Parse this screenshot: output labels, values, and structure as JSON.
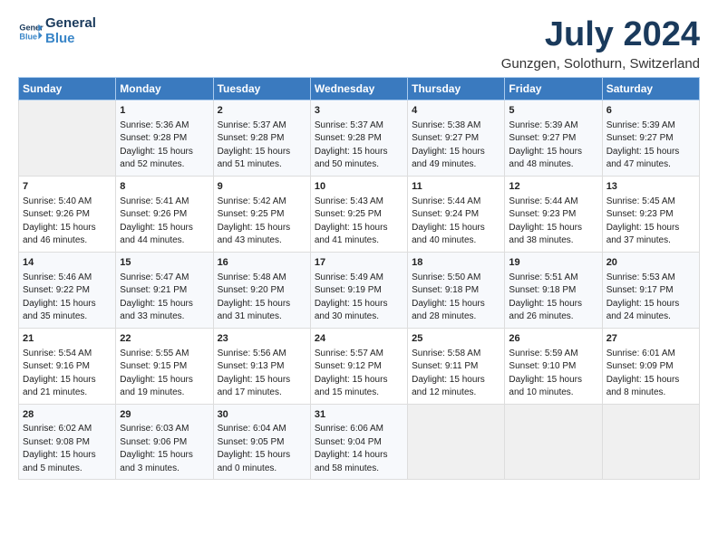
{
  "header": {
    "logo_line1": "General",
    "logo_line2": "Blue",
    "title": "July 2024",
    "subtitle": "Gunzgen, Solothurn, Switzerland"
  },
  "days_of_week": [
    "Sunday",
    "Monday",
    "Tuesday",
    "Wednesday",
    "Thursday",
    "Friday",
    "Saturday"
  ],
  "weeks": [
    [
      {
        "day": "",
        "content": ""
      },
      {
        "day": "1",
        "content": "Sunrise: 5:36 AM\nSunset: 9:28 PM\nDaylight: 15 hours\nand 52 minutes."
      },
      {
        "day": "2",
        "content": "Sunrise: 5:37 AM\nSunset: 9:28 PM\nDaylight: 15 hours\nand 51 minutes."
      },
      {
        "day": "3",
        "content": "Sunrise: 5:37 AM\nSunset: 9:28 PM\nDaylight: 15 hours\nand 50 minutes."
      },
      {
        "day": "4",
        "content": "Sunrise: 5:38 AM\nSunset: 9:27 PM\nDaylight: 15 hours\nand 49 minutes."
      },
      {
        "day": "5",
        "content": "Sunrise: 5:39 AM\nSunset: 9:27 PM\nDaylight: 15 hours\nand 48 minutes."
      },
      {
        "day": "6",
        "content": "Sunrise: 5:39 AM\nSunset: 9:27 PM\nDaylight: 15 hours\nand 47 minutes."
      }
    ],
    [
      {
        "day": "7",
        "content": "Sunrise: 5:40 AM\nSunset: 9:26 PM\nDaylight: 15 hours\nand 46 minutes."
      },
      {
        "day": "8",
        "content": "Sunrise: 5:41 AM\nSunset: 9:26 PM\nDaylight: 15 hours\nand 44 minutes."
      },
      {
        "day": "9",
        "content": "Sunrise: 5:42 AM\nSunset: 9:25 PM\nDaylight: 15 hours\nand 43 minutes."
      },
      {
        "day": "10",
        "content": "Sunrise: 5:43 AM\nSunset: 9:25 PM\nDaylight: 15 hours\nand 41 minutes."
      },
      {
        "day": "11",
        "content": "Sunrise: 5:44 AM\nSunset: 9:24 PM\nDaylight: 15 hours\nand 40 minutes."
      },
      {
        "day": "12",
        "content": "Sunrise: 5:44 AM\nSunset: 9:23 PM\nDaylight: 15 hours\nand 38 minutes."
      },
      {
        "day": "13",
        "content": "Sunrise: 5:45 AM\nSunset: 9:23 PM\nDaylight: 15 hours\nand 37 minutes."
      }
    ],
    [
      {
        "day": "14",
        "content": "Sunrise: 5:46 AM\nSunset: 9:22 PM\nDaylight: 15 hours\nand 35 minutes."
      },
      {
        "day": "15",
        "content": "Sunrise: 5:47 AM\nSunset: 9:21 PM\nDaylight: 15 hours\nand 33 minutes."
      },
      {
        "day": "16",
        "content": "Sunrise: 5:48 AM\nSunset: 9:20 PM\nDaylight: 15 hours\nand 31 minutes."
      },
      {
        "day": "17",
        "content": "Sunrise: 5:49 AM\nSunset: 9:19 PM\nDaylight: 15 hours\nand 30 minutes."
      },
      {
        "day": "18",
        "content": "Sunrise: 5:50 AM\nSunset: 9:18 PM\nDaylight: 15 hours\nand 28 minutes."
      },
      {
        "day": "19",
        "content": "Sunrise: 5:51 AM\nSunset: 9:18 PM\nDaylight: 15 hours\nand 26 minutes."
      },
      {
        "day": "20",
        "content": "Sunrise: 5:53 AM\nSunset: 9:17 PM\nDaylight: 15 hours\nand 24 minutes."
      }
    ],
    [
      {
        "day": "21",
        "content": "Sunrise: 5:54 AM\nSunset: 9:16 PM\nDaylight: 15 hours\nand 21 minutes."
      },
      {
        "day": "22",
        "content": "Sunrise: 5:55 AM\nSunset: 9:15 PM\nDaylight: 15 hours\nand 19 minutes."
      },
      {
        "day": "23",
        "content": "Sunrise: 5:56 AM\nSunset: 9:13 PM\nDaylight: 15 hours\nand 17 minutes."
      },
      {
        "day": "24",
        "content": "Sunrise: 5:57 AM\nSunset: 9:12 PM\nDaylight: 15 hours\nand 15 minutes."
      },
      {
        "day": "25",
        "content": "Sunrise: 5:58 AM\nSunset: 9:11 PM\nDaylight: 15 hours\nand 12 minutes."
      },
      {
        "day": "26",
        "content": "Sunrise: 5:59 AM\nSunset: 9:10 PM\nDaylight: 15 hours\nand 10 minutes."
      },
      {
        "day": "27",
        "content": "Sunrise: 6:01 AM\nSunset: 9:09 PM\nDaylight: 15 hours\nand 8 minutes."
      }
    ],
    [
      {
        "day": "28",
        "content": "Sunrise: 6:02 AM\nSunset: 9:08 PM\nDaylight: 15 hours\nand 5 minutes."
      },
      {
        "day": "29",
        "content": "Sunrise: 6:03 AM\nSunset: 9:06 PM\nDaylight: 15 hours\nand 3 minutes."
      },
      {
        "day": "30",
        "content": "Sunrise: 6:04 AM\nSunset: 9:05 PM\nDaylight: 15 hours\nand 0 minutes."
      },
      {
        "day": "31",
        "content": "Sunrise: 6:06 AM\nSunset: 9:04 PM\nDaylight: 14 hours\nand 58 minutes."
      },
      {
        "day": "",
        "content": ""
      },
      {
        "day": "",
        "content": ""
      },
      {
        "day": "",
        "content": ""
      }
    ]
  ]
}
